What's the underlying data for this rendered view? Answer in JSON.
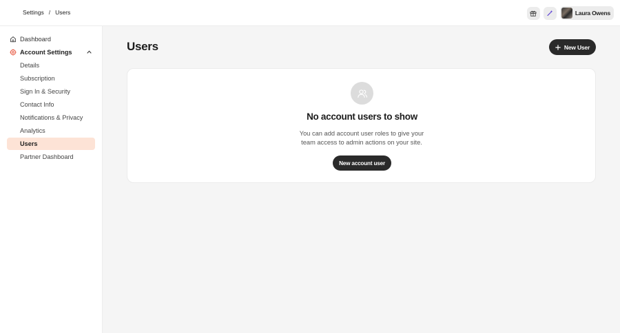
{
  "breadcrumb": {
    "root": "Settings",
    "separator": "/",
    "current": "Users"
  },
  "topbar": {
    "user_name": "Laura Owens",
    "icons": [
      "gift-icon",
      "sparkle-icon"
    ]
  },
  "sidebar": {
    "items": [
      {
        "label": "Dashboard",
        "icon": "home-icon"
      },
      {
        "label": "Account Settings",
        "icon": "gear-icon",
        "expanded": true
      },
      {
        "label": "Details"
      },
      {
        "label": "Subscription"
      },
      {
        "label": "Sign In & Security"
      },
      {
        "label": "Contact Info"
      },
      {
        "label": "Notifications & Privacy"
      },
      {
        "label": "Analytics"
      },
      {
        "label": "Users",
        "active": true
      },
      {
        "label": "Partner Dashboard"
      }
    ]
  },
  "main": {
    "title": "Users",
    "new_user_label": "New User",
    "empty_state": {
      "icon": "users-icon",
      "title": "No account users to show",
      "description": "You can add account user roles to give your team access to admin actions on your site.",
      "cta_label": "New account user"
    }
  },
  "colors": {
    "accent": "#e8604a",
    "active_bg": "#fde3d6",
    "button_bg": "#2a2a2a"
  }
}
